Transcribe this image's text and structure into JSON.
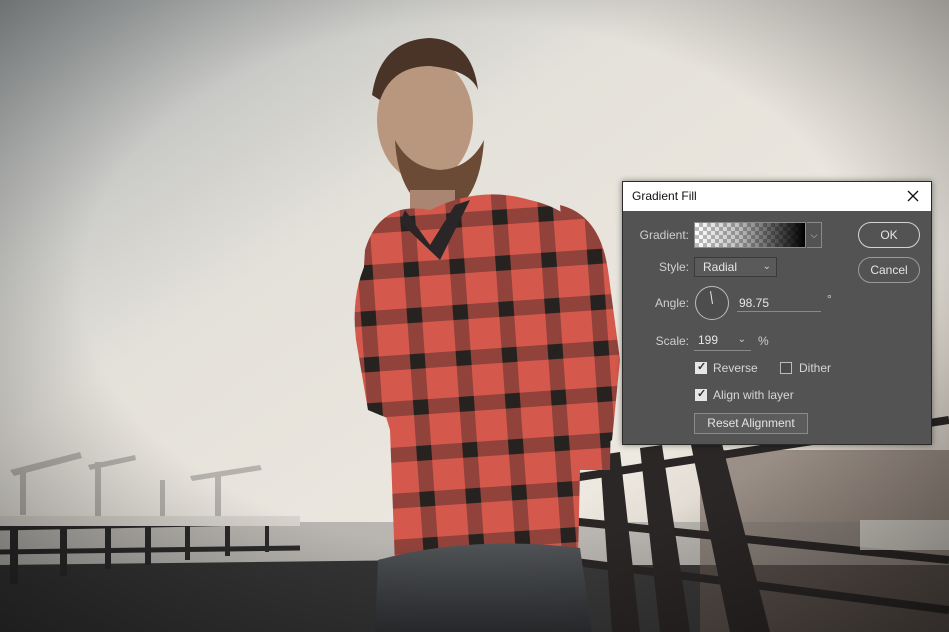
{
  "dialog": {
    "title": "Gradient Fill",
    "gradient_label": "Gradient:",
    "style_label": "Style:",
    "style_value": "Radial",
    "angle_label": "Angle:",
    "angle_value": "98.75",
    "angle_unit": "°",
    "scale_label": "Scale:",
    "scale_value": "199",
    "scale_unit": "%",
    "reverse_label": "Reverse",
    "reverse_checked": true,
    "dither_label": "Dither",
    "dither_checked": false,
    "align_label": "Align with layer",
    "align_checked": true,
    "reset_label": "Reset Alignment",
    "ok_label": "OK",
    "cancel_label": "Cancel"
  },
  "icons": {
    "close": "close-icon",
    "dropdown": "chevron-down-icon"
  },
  "colors": {
    "dialog_bg": "#535353",
    "titlebar_bg": "#ffffff",
    "shirt_red": "#d2584b",
    "shirt_dark": "#2a2526",
    "sky": "#e6e2da"
  }
}
